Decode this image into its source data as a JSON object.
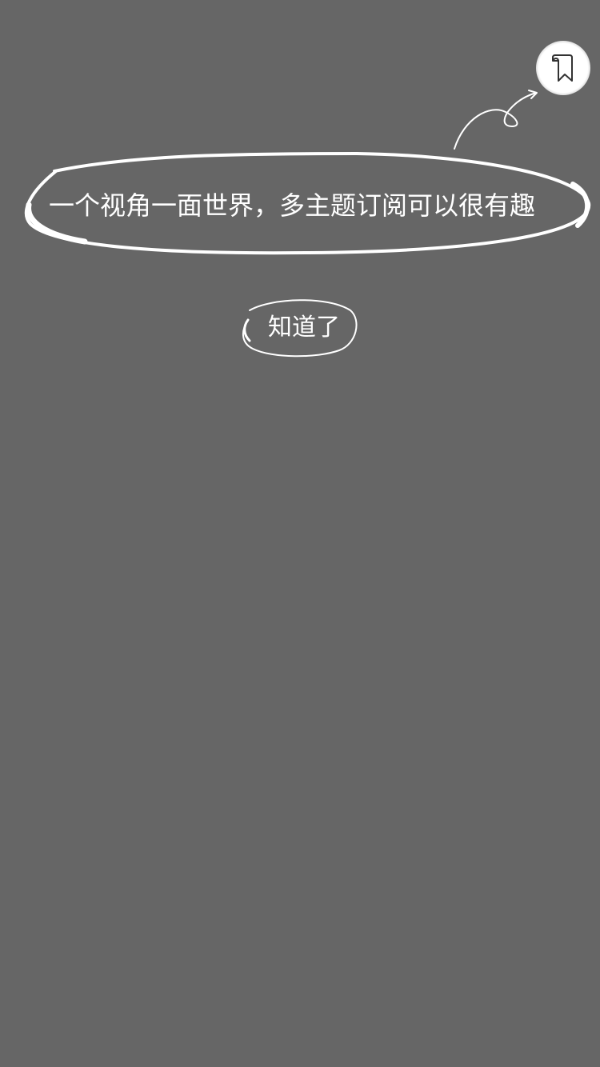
{
  "colors": {
    "overlay": "#666666",
    "foreground": "#ffffff",
    "icon_stroke": "#333333"
  },
  "highlight": {
    "icon": "bookmark-icon"
  },
  "tip": {
    "text": "一个视角一面世界，多主题订阅可以很有趣"
  },
  "dismiss_button": {
    "label": "知道了"
  }
}
